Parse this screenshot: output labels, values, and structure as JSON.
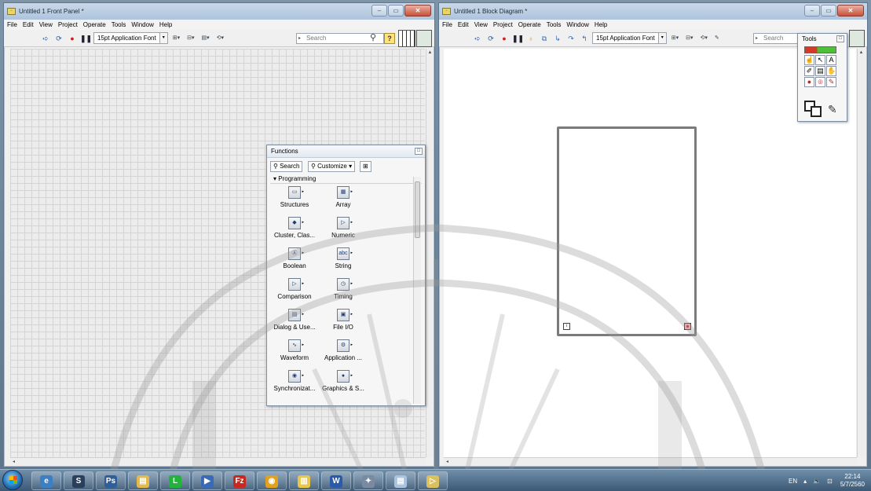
{
  "front_panel": {
    "title": "Untitled 1 Front Panel *",
    "menus": [
      "File",
      "Edit",
      "View",
      "Project",
      "Operate",
      "Tools",
      "Window",
      "Help"
    ],
    "font_select": "15pt Application Font",
    "search_placeholder": "Search",
    "help_label": "?"
  },
  "block_diagram": {
    "title": "Untitled 1 Block Diagram *",
    "menus": [
      "File",
      "Edit",
      "View",
      "Project",
      "Operate",
      "Tools",
      "Window",
      "Help"
    ],
    "font_select": "15pt Application Font",
    "search_placeholder": "Search",
    "while_loop": {
      "iteration_label": "i"
    }
  },
  "functions_palette": {
    "title": "Functions",
    "search_label": "Search",
    "customize_label": "Customize",
    "category": "Programming",
    "items": [
      {
        "label": "Structures",
        "icon": "structures-icon"
      },
      {
        "label": "Array",
        "icon": "array-icon"
      },
      {
        "label": "Cluster, Clas...",
        "icon": "cluster-icon"
      },
      {
        "label": "Numeric",
        "icon": "numeric-icon"
      },
      {
        "label": "Boolean",
        "icon": "boolean-icon"
      },
      {
        "label": "String",
        "icon": "string-icon"
      },
      {
        "label": "Comparison",
        "icon": "comparison-icon"
      },
      {
        "label": "Timing",
        "icon": "timing-icon"
      },
      {
        "label": "Dialog & Use...",
        "icon": "dialog-icon"
      },
      {
        "label": "File I/O",
        "icon": "file-io-icon"
      },
      {
        "label": "Waveform",
        "icon": "waveform-icon"
      },
      {
        "label": "Application ...",
        "icon": "application-icon"
      },
      {
        "label": "Synchronizat...",
        "icon": "synchronization-icon"
      },
      {
        "label": "Graphics & S...",
        "icon": "graphics-icon"
      }
    ]
  },
  "tools_palette": {
    "title": "Tools"
  },
  "taskbar": {
    "apps": [
      "explorer",
      "steam",
      "photoshop",
      "file-manager",
      "line",
      "media",
      "filezilla",
      "chrome",
      "labview",
      "word",
      "tools",
      "notepad",
      "labview-active"
    ],
    "lang": "EN",
    "time": "22:14",
    "date": "5/7/2560"
  },
  "colors": {
    "loop_border": "#7b7b7b",
    "title_bar": "#b8cce0",
    "taskbar": "#4a6a88"
  }
}
